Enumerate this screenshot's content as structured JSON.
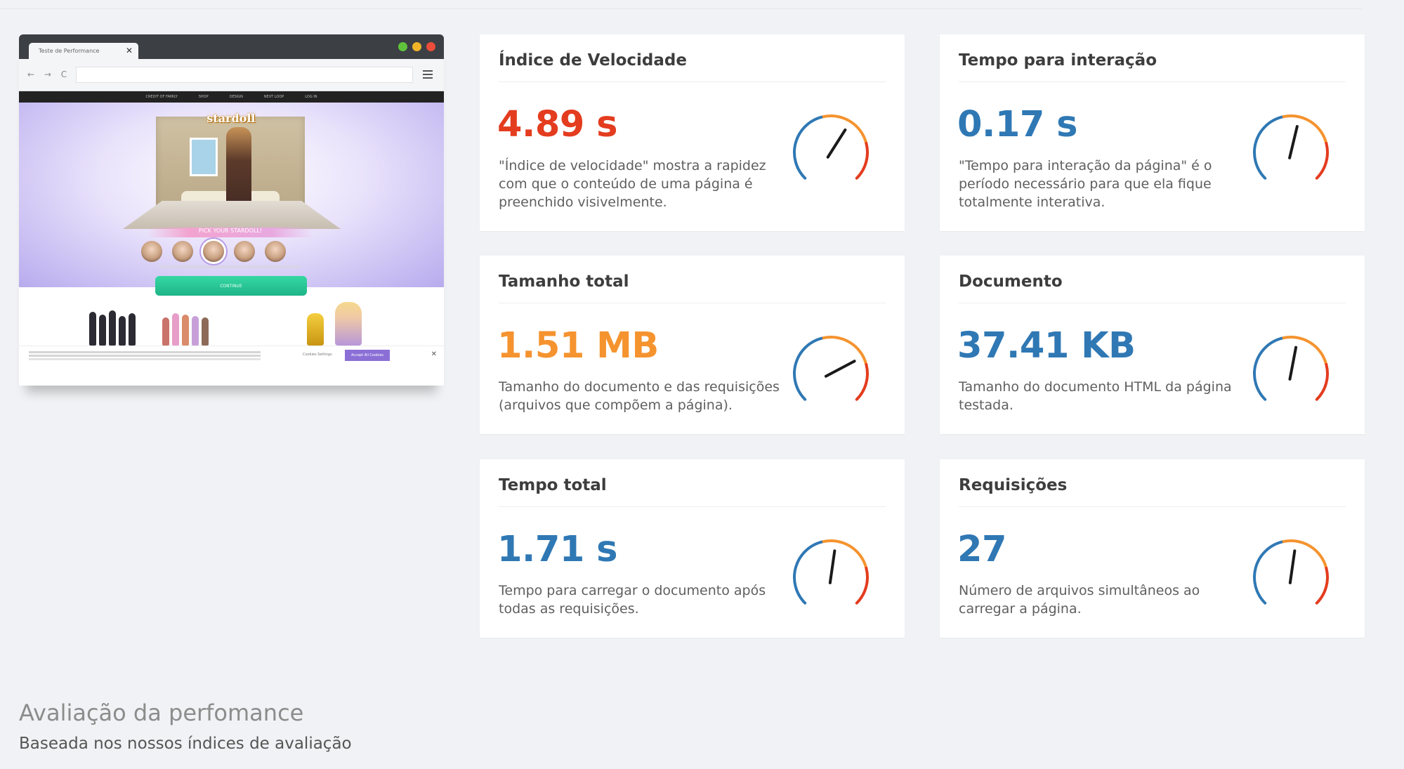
{
  "preview": {
    "tab_label": "Teste de Performance",
    "tab_close": "✕",
    "nav_glyphs": "← → C",
    "site_nav": [
      "CREDIT OF FAMILY",
      "SHOP",
      "DESIGN",
      "NEXT LOOP",
      "LOG IN"
    ],
    "site_logo": "stardoll",
    "hero_banner": "PICK YOUR STARDOLL!",
    "cta_label": "CONTINUE",
    "cookie_settings": "Cookies Settings",
    "cookie_accept": "Accept All Cookies",
    "cookie_close": "✕",
    "window_dot_colors": [
      "#5fc43b",
      "#f0b429",
      "#ec4d3b"
    ]
  },
  "cards": {
    "speed": {
      "title": "Índice de Velocidade",
      "value": "4.89 s",
      "value_color": "#e43c1f",
      "description": "\"Índice de velocidade\" mostra a rapidez com que o conteúdo de uma página é preenchido visivelmente."
    },
    "interaction": {
      "title": "Tempo para interação",
      "value": "0.17 s",
      "value_color": "#2f78b4",
      "description": "\"Tempo para interação da página\" é o período necessário para que ela fique totalmente interativa."
    },
    "size": {
      "title": "Tamanho total",
      "value": "1.51 MB",
      "value_color": "#f5932f",
      "description": "Tamanho do documento e das requisições (arquivos que compõem a página)."
    },
    "document": {
      "title": "Documento",
      "value": "37.41 KB",
      "value_color": "#2f78b4",
      "description": "Tamanho do documento HTML da página testada."
    },
    "total_time": {
      "title": "Tempo total",
      "value": "1.71 s",
      "value_color": "#2f78b4",
      "description": "Tempo para carregar o documento após todas as requisições."
    },
    "requests": {
      "title": "Requisições",
      "value": "27",
      "value_color": "#2f78b4",
      "description": "Número de arquivos simultâneos ao carregar a página."
    }
  },
  "gauge_colors": {
    "good": "#2f78b4",
    "medium": "#f5932f",
    "bad": "#e43c1f",
    "needle": "#1a1a1a"
  },
  "gauge_levels": {
    "speed": 0.62,
    "interaction": 0.55,
    "size": 0.73,
    "document": 0.54,
    "total_time": 0.53,
    "requests": 0.53
  },
  "footer": {
    "title": "Avaliação da perfomance",
    "subtitle": "Baseada nos nossos índices de avaliação"
  }
}
